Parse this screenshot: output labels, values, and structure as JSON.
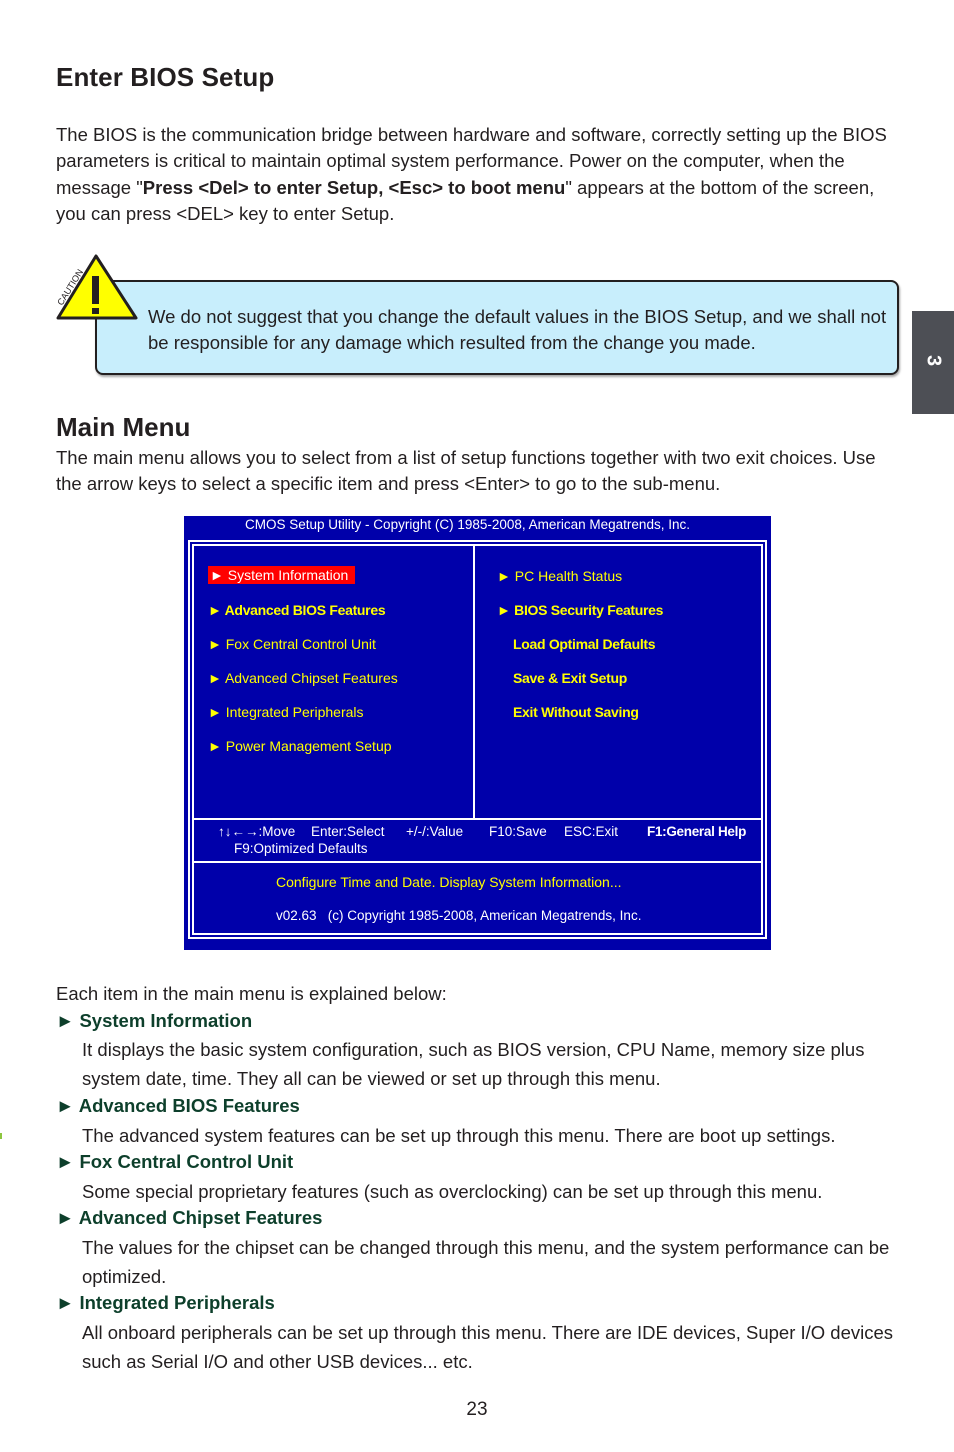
{
  "page": {
    "title": "Enter BIOS Setup",
    "intro_paragraph": {
      "before_bold": "The BIOS is the communication bridge between hardware and software, correctly setting up the BIOS parameters is critical to maintain optimal system performance. Power on the computer, when the message \"",
      "bold": "Press <Del> to enter Setup, <Esc> to boot menu",
      "after_bold": "\" appears at the bottom of the screen, you can press <DEL> key to enter Setup."
    },
    "caution": {
      "icon_label": "CAUTION",
      "icon_glyph": "!",
      "text": "We do not suggest that you change the default values in the BIOS Setup, and we shall not be responsible for any damage which resulted from the change you made."
    },
    "chapter_tab": "3",
    "main_menu": {
      "title": "Main Menu",
      "description": "The main menu allows you to select from a list of setup functions together with two exit choices. Use the arrow keys to select a specific item and press <Enter> to go to the sub-menu."
    },
    "page_number": "23"
  },
  "bios": {
    "header": "CMOS Setup Utility - Copyright (C) 1985-2008, American Megatrends, Inc.",
    "left_items": [
      {
        "label": "► System Information",
        "selected": true
      },
      {
        "label": "► Advanced BIOS Features"
      },
      {
        "label": "► Fox Central Control Unit"
      },
      {
        "label": "► Advanced Chipset Features"
      },
      {
        "label": "► Integrated Peripherals"
      },
      {
        "label": "► Power Management Setup"
      }
    ],
    "right_items": [
      {
        "label": "► PC Health Status"
      },
      {
        "label": "► BIOS Security Features"
      },
      {
        "label": "Load Optimal Defaults"
      },
      {
        "label": "Save & Exit Setup"
      },
      {
        "label": "Exit Without Saving"
      }
    ],
    "keys": {
      "move": "↑↓←→:Move",
      "select": "Enter:Select",
      "value": "+/-/:Value",
      "save": "F10:Save",
      "exit": "ESC:Exit",
      "help": "F1:General Help",
      "defaults": "F9:Optimized Defaults"
    },
    "help_text": "Configure Time and Date.  Display System Information...",
    "version_line": "v02.63   (c) Copyright 1985-2008, American Megatrends, Inc.",
    "colors": {
      "background": "#0000aa",
      "item_text": "#ffff00",
      "selected_bg": "#ff0000",
      "border": "#ffffff"
    }
  },
  "explanations": {
    "intro": "Each item in the main menu is explained below:",
    "items": [
      {
        "heading": "► System Information",
        "text": "It displays the basic system configuration, such as BIOS version, CPU Name, memory size plus system date, time. They all can be viewed or set up through this menu."
      },
      {
        "heading": "► Advanced BIOS Features",
        "text": "The advanced system features can be set up through this menu. There are boot up settings."
      },
      {
        "heading": "► Fox Central Control Unit",
        "text": "Some special proprietary features (such as overclocking) can be set up through this menu."
      },
      {
        "heading": "► Advanced Chipset Features",
        "text": "The values for the chipset can be changed through this menu, and the system performance can be optimized."
      },
      {
        "heading": "► Integrated Peripherals",
        "text": "All onboard peripherals can be set up through this menu. There are IDE devices, Super I/O devices such as Serial I/O and other USB devices... etc."
      }
    ],
    "heading_color": "#0d3f2b"
  }
}
